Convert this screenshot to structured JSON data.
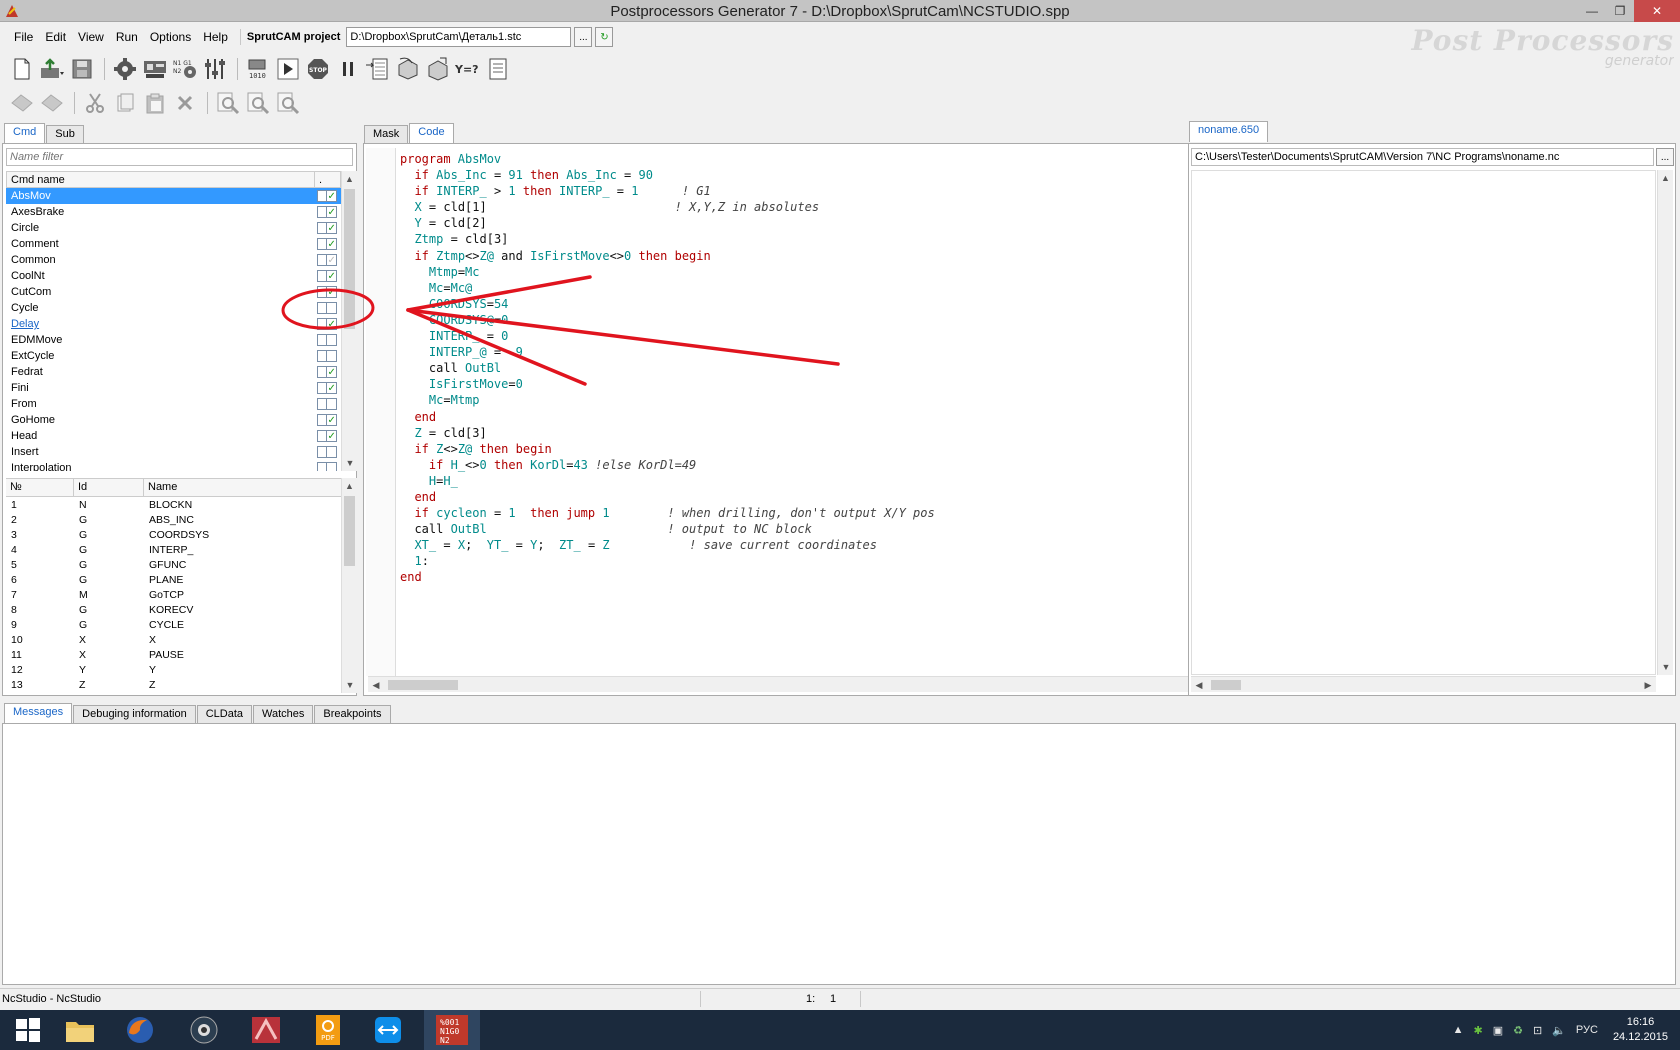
{
  "window": {
    "title": "Postprocessors Generator 7 - D:\\Dropbox\\SprutCam\\NCSTUDIO.spp",
    "minimize_glyph": "—",
    "restore_glyph": "❐",
    "close_glyph": "✕"
  },
  "menu": {
    "items": [
      "File",
      "Edit",
      "View",
      "Run",
      "Options",
      "Help"
    ],
    "project_label": "SprutCAM project",
    "project_path": "D:\\Dropbox\\SprutCam\\Деталь1.stc",
    "browse_label": "...",
    "refresh_glyph": "↻"
  },
  "logo": {
    "line1": "Post Processors",
    "line2": "generator"
  },
  "toolbar1": {
    "stop_label": "STOP",
    "yes_label": "Y=?"
  },
  "left_tabs": [
    "Cmd",
    "Sub"
  ],
  "name_filter_placeholder": "Name filter",
  "cmd_table": {
    "header_name": "Cmd name",
    "header_flag": ".",
    "rows": [
      {
        "name": "AbsMov",
        "checked": true,
        "selected": true,
        "link": false
      },
      {
        "name": "AxesBrake",
        "checked": true,
        "selected": false,
        "link": false
      },
      {
        "name": "Circle",
        "checked": true,
        "selected": false,
        "link": false
      },
      {
        "name": "Comment",
        "checked": true,
        "selected": false,
        "link": false
      },
      {
        "name": "Common",
        "checked": "gray",
        "selected": false,
        "link": false
      },
      {
        "name": "CoolNt",
        "checked": true,
        "selected": false,
        "link": false
      },
      {
        "name": "CutCom",
        "checked": true,
        "selected": false,
        "link": false
      },
      {
        "name": "Cycle",
        "checked": false,
        "selected": false,
        "link": false
      },
      {
        "name": "Delay",
        "checked": true,
        "selected": false,
        "link": true
      },
      {
        "name": "EDMMove",
        "checked": false,
        "selected": false,
        "link": false
      },
      {
        "name": "ExtCycle",
        "checked": false,
        "selected": false,
        "link": false
      },
      {
        "name": "Fedrat",
        "checked": true,
        "selected": false,
        "link": false
      },
      {
        "name": "Fini",
        "checked": true,
        "selected": false,
        "link": false
      },
      {
        "name": "From",
        "checked": false,
        "selected": false,
        "link": false
      },
      {
        "name": "GoHome",
        "checked": true,
        "selected": false,
        "link": false
      },
      {
        "name": "Head",
        "checked": true,
        "selected": false,
        "link": false
      },
      {
        "name": "Insert",
        "checked": false,
        "selected": false,
        "link": false
      },
      {
        "name": "Interpolation",
        "checked": false,
        "selected": false,
        "link": false
      }
    ]
  },
  "id_table": {
    "headers": [
      "№",
      "Id",
      "Name"
    ],
    "rows": [
      [
        "1",
        "N",
        "BLOCKN"
      ],
      [
        "2",
        "G",
        "ABS_INC"
      ],
      [
        "3",
        "G",
        "COORDSYS"
      ],
      [
        "4",
        "G",
        "INTERP_"
      ],
      [
        "5",
        "G",
        "GFUNC"
      ],
      [
        "6",
        "G",
        "PLANE"
      ],
      [
        "7",
        "M",
        "GoTCP"
      ],
      [
        "8",
        "G",
        "KORECV"
      ],
      [
        "9",
        "G",
        "CYCLE"
      ],
      [
        "10",
        "X",
        "X"
      ],
      [
        "11",
        "X",
        "PAUSE"
      ],
      [
        "12",
        "Y",
        "Y"
      ],
      [
        "13",
        "Z",
        "Z"
      ]
    ]
  },
  "editor_tabs": [
    "Mask",
    "Code"
  ],
  "code_lines": [
    [
      [
        "kw",
        "program "
      ],
      [
        "id",
        "AbsMov"
      ]
    ],
    [
      [
        "",
        "  "
      ],
      [
        "kw",
        "if "
      ],
      [
        "id",
        "Abs_Inc"
      ],
      [
        "",
        " = "
      ],
      [
        "nu",
        "91"
      ],
      [
        "kw",
        " then "
      ],
      [
        "id",
        "Abs_Inc"
      ],
      [
        "",
        " = "
      ],
      [
        "nu",
        "90"
      ]
    ],
    [
      [
        "",
        "  "
      ],
      [
        "kw",
        "if "
      ],
      [
        "id",
        "INTERP_"
      ],
      [
        "",
        " > "
      ],
      [
        "nu",
        "1"
      ],
      [
        "kw",
        " then "
      ],
      [
        "id",
        "INTERP_"
      ],
      [
        "",
        " = "
      ],
      [
        "nu",
        "1"
      ],
      [
        "",
        "      "
      ],
      [
        "cm",
        "! G1"
      ]
    ],
    [
      [
        "",
        "  "
      ],
      [
        "id",
        "X"
      ],
      [
        "",
        " = "
      ],
      [
        "",
        "cld[1]"
      ],
      [
        "",
        "                          "
      ],
      [
        "cm",
        "! X,Y,Z in absolutes"
      ]
    ],
    [
      [
        "",
        "  "
      ],
      [
        "id",
        "Y"
      ],
      [
        "",
        " = "
      ],
      [
        "",
        "cld[2]"
      ]
    ],
    [
      [
        "",
        "  "
      ],
      [
        "id",
        "Ztmp"
      ],
      [
        "",
        " = "
      ],
      [
        "",
        "cld[3]"
      ]
    ],
    [
      [
        "",
        "  "
      ],
      [
        "kw",
        "if "
      ],
      [
        "id",
        "Ztmp"
      ],
      [
        "",
        "<>"
      ],
      [
        "id",
        "Z@"
      ],
      [
        "",
        " and "
      ],
      [
        "id",
        "IsFirstMove"
      ],
      [
        "",
        "<>"
      ],
      [
        "nu",
        "0"
      ],
      [
        "kw",
        " then begin"
      ]
    ],
    [
      [
        "",
        "    "
      ],
      [
        "id",
        "Mtmp"
      ],
      [
        "",
        "="
      ],
      [
        "id",
        "Mc"
      ]
    ],
    [
      [
        "",
        "    "
      ],
      [
        "id",
        "Mc"
      ],
      [
        "",
        "="
      ],
      [
        "id",
        "Mc@"
      ]
    ],
    [
      [
        "",
        "    "
      ],
      [
        "id",
        "COORDSYS"
      ],
      [
        "",
        "="
      ],
      [
        "nu",
        "54"
      ]
    ],
    [
      [
        "",
        "    "
      ],
      [
        "id",
        "COORDSYS@"
      ],
      [
        "",
        "="
      ],
      [
        "nu",
        "0"
      ]
    ],
    [
      [
        "",
        "    "
      ],
      [
        "id",
        "INTERP_"
      ],
      [
        "",
        " = "
      ],
      [
        "nu",
        "0"
      ]
    ],
    [
      [
        "",
        "    "
      ],
      [
        "id",
        "INTERP_@"
      ],
      [
        "",
        " = "
      ],
      [
        "nu",
        "-9"
      ]
    ],
    [
      [
        "",
        "    "
      ],
      [
        "",
        "call "
      ],
      [
        "id",
        "OutBl"
      ]
    ],
    [
      [
        "",
        "    "
      ],
      [
        "id",
        "IsFirstMove"
      ],
      [
        "",
        "="
      ],
      [
        "nu",
        "0"
      ]
    ],
    [
      [
        "",
        "    "
      ],
      [
        "id",
        "Mc"
      ],
      [
        "",
        "="
      ],
      [
        "id",
        "Mtmp"
      ]
    ],
    [
      [
        "",
        "  "
      ],
      [
        "kw",
        "end"
      ]
    ],
    [
      [
        "",
        "  "
      ],
      [
        "id",
        "Z"
      ],
      [
        "",
        " = "
      ],
      [
        "",
        "cld[3]"
      ]
    ],
    [
      [
        "",
        "  "
      ],
      [
        "kw",
        "if "
      ],
      [
        "id",
        "Z"
      ],
      [
        "",
        "<>"
      ],
      [
        "id",
        "Z@"
      ],
      [
        "kw",
        " then begin"
      ]
    ],
    [
      [
        "",
        "    "
      ],
      [
        "kw",
        "if "
      ],
      [
        "id",
        "H_"
      ],
      [
        "",
        "<>"
      ],
      [
        "nu",
        "0"
      ],
      [
        "kw",
        " then "
      ],
      [
        "id",
        "KorDl"
      ],
      [
        "",
        "="
      ],
      [
        "nu",
        "43"
      ],
      [
        "",
        " "
      ],
      [
        "cm",
        "!else KorDl=49"
      ]
    ],
    [
      [
        "",
        "    "
      ],
      [
        "id",
        "H"
      ],
      [
        "",
        "="
      ],
      [
        "id",
        "H_"
      ]
    ],
    [
      [
        "",
        "  "
      ],
      [
        "kw",
        "end"
      ]
    ],
    [
      [
        "",
        "  "
      ],
      [
        "kw",
        "if "
      ],
      [
        "id",
        "cycleon"
      ],
      [
        "",
        " = "
      ],
      [
        "nu",
        "1"
      ],
      [
        "kw",
        "  then jump "
      ],
      [
        "nu",
        "1"
      ],
      [
        "",
        "        "
      ],
      [
        "cm",
        "! when drilling, don't output X/Y pos"
      ]
    ],
    [
      [
        "",
        "  "
      ],
      [
        "",
        "call "
      ],
      [
        "id",
        "OutBl"
      ],
      [
        "",
        "                         "
      ],
      [
        "cm",
        "! output to NC block"
      ]
    ],
    [
      [
        "",
        "  "
      ],
      [
        "id",
        "XT_"
      ],
      [
        "",
        " = "
      ],
      [
        "id",
        "X"
      ],
      [
        "",
        ";  "
      ],
      [
        "id",
        "YT_"
      ],
      [
        "",
        " = "
      ],
      [
        "id",
        "Y"
      ],
      [
        "",
        ";  "
      ],
      [
        "id",
        "ZT_"
      ],
      [
        "",
        " = "
      ],
      [
        "id",
        "Z"
      ],
      [
        "",
        "           "
      ],
      [
        "cm",
        "! save current coordinates"
      ]
    ],
    [
      [
        "",
        "  "
      ],
      [
        "nu",
        "1"
      ],
      [
        "",
        ":"
      ]
    ],
    [
      [
        "kw",
        "end"
      ]
    ]
  ],
  "right_tab": "noname.650",
  "nc_path": "C:\\Users\\Tester\\Documents\\SprutCAM\\Version 7\\NC Programs\\noname.nc",
  "nc_browse_label": "...",
  "bottom_tabs": [
    "Messages",
    "Debuging information",
    "CLData",
    "Watches",
    "Breakpoints"
  ],
  "status": {
    "left": "NcStudio - NcStudio",
    "line": "1:",
    "col": "1"
  },
  "tray": {
    "language": "РУС",
    "time": "16:16",
    "date": "24.12.2015"
  },
  "colors": {
    "selection": "#3399ff",
    "keyword": "#b00000",
    "identifier": "#008b8b",
    "annotation": "#e0141e",
    "taskbar": "#1b2a3d"
  }
}
